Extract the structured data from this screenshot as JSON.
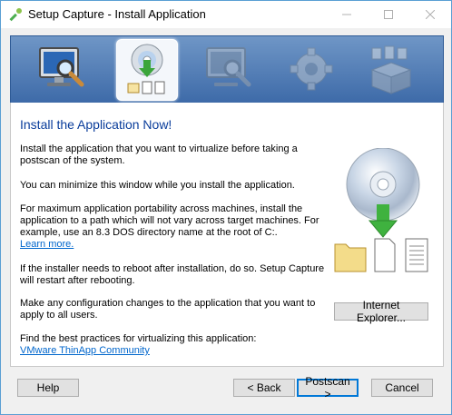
{
  "window": {
    "title": "Setup Capture - Install Application"
  },
  "steps": [
    {
      "name": "prescan",
      "active": false
    },
    {
      "name": "install",
      "active": true
    },
    {
      "name": "postscan",
      "active": false
    },
    {
      "name": "configure",
      "active": false
    },
    {
      "name": "build",
      "active": false
    }
  ],
  "main": {
    "heading": "Install the Application Now!",
    "p1": "Install the application that you want to virtualize before taking a postscan of the system.",
    "p2": "You can minimize this window while you install the application.",
    "p3": "For maximum application portability across machines, install the application to a path which will not vary across target machines. For example, use an 8.3 DOS directory name at the root of C:.",
    "p3_link": "Learn more.",
    "p4": "If the installer needs to reboot after installation, do so. Setup Capture will restart after rebooting.",
    "p5": "Make any configuration changes to the application that you want to apply to all users.",
    "p6": "Find the best practices for virtualizing this application:",
    "p6_link": "VMware ThinApp Community",
    "ie_button": "Internet Explorer..."
  },
  "footer": {
    "help": "Help",
    "back": "< Back",
    "postscan": "Postscan >",
    "cancel": "Cancel"
  },
  "colors": {
    "heading": "#0a3d9b",
    "link": "#0066cc",
    "banner": "#4f7ab4",
    "default_button": "#0078d7"
  }
}
